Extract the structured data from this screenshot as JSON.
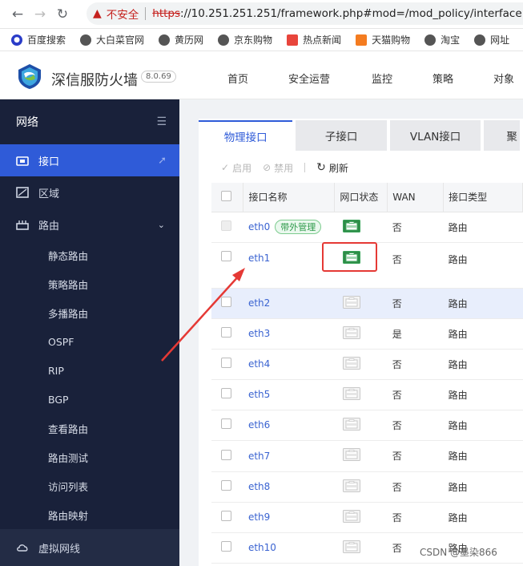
{
  "browser": {
    "not_secure": "不安全",
    "url_scheme": "https",
    "url_rest": "://10.251.251.251/framework.php#mod=/mod_policy/interface",
    "bookmarks": [
      "百度搜索",
      "大白菜官网",
      "黄历网",
      "京东购物",
      "热点新闻",
      "天猫购物",
      "淘宝",
      "网址"
    ]
  },
  "header": {
    "brand": "深信服防火墙",
    "version": "8.0.69",
    "nav": [
      "首页",
      "安全运营",
      "监控",
      "策略",
      "对象"
    ]
  },
  "sidebar": {
    "title": "网络",
    "items": [
      {
        "label": "接口",
        "icon": "interface-icon"
      },
      {
        "label": "区域",
        "icon": "zone-icon"
      },
      {
        "label": "路由",
        "icon": "route-icon"
      }
    ],
    "subitems": [
      "静态路由",
      "策略路由",
      "多播路由",
      "OSPF",
      "RIP",
      "BGP",
      "查看路由",
      "路由测试",
      "访问列表",
      "路由映射"
    ],
    "bottom": "虚拟网线"
  },
  "tabs": [
    "物理接口",
    "子接口",
    "VLAN接口",
    "聚"
  ],
  "toolbar": {
    "enable": "启用",
    "disable": "禁用",
    "refresh": "刷新"
  },
  "table": {
    "headers": [
      "接口名称",
      "网口状态",
      "WAN",
      "接口类型"
    ],
    "rows": [
      {
        "name": "eth0",
        "badge": "带外管理",
        "status": "up",
        "wan": "否",
        "type": "路由"
      },
      {
        "name": "eth1",
        "badge": "",
        "status": "up",
        "wan": "否",
        "type": "路由"
      },
      {
        "name": "eth2",
        "badge": "",
        "status": "down",
        "wan": "否",
        "type": "路由"
      },
      {
        "name": "eth3",
        "badge": "",
        "status": "down",
        "wan": "是",
        "type": "路由"
      },
      {
        "name": "eth4",
        "badge": "",
        "status": "down",
        "wan": "否",
        "type": "路由"
      },
      {
        "name": "eth5",
        "badge": "",
        "status": "down",
        "wan": "否",
        "type": "路由"
      },
      {
        "name": "eth6",
        "badge": "",
        "status": "down",
        "wan": "否",
        "type": "路由"
      },
      {
        "name": "eth7",
        "badge": "",
        "status": "down",
        "wan": "否",
        "type": "路由"
      },
      {
        "name": "eth8",
        "badge": "",
        "status": "down",
        "wan": "否",
        "type": "路由"
      },
      {
        "name": "eth9",
        "badge": "",
        "status": "down",
        "wan": "否",
        "type": "路由"
      },
      {
        "name": "eth10",
        "badge": "",
        "status": "down",
        "wan": "否",
        "type": "路由"
      }
    ]
  },
  "watermark": "CSDN @墨染866",
  "colors": {
    "accent": "#2f5bd8",
    "sidebar": "#19213a",
    "port_up": "#3aa55a",
    "port_down": "#c8c8c8",
    "annotation": "#e53935"
  }
}
